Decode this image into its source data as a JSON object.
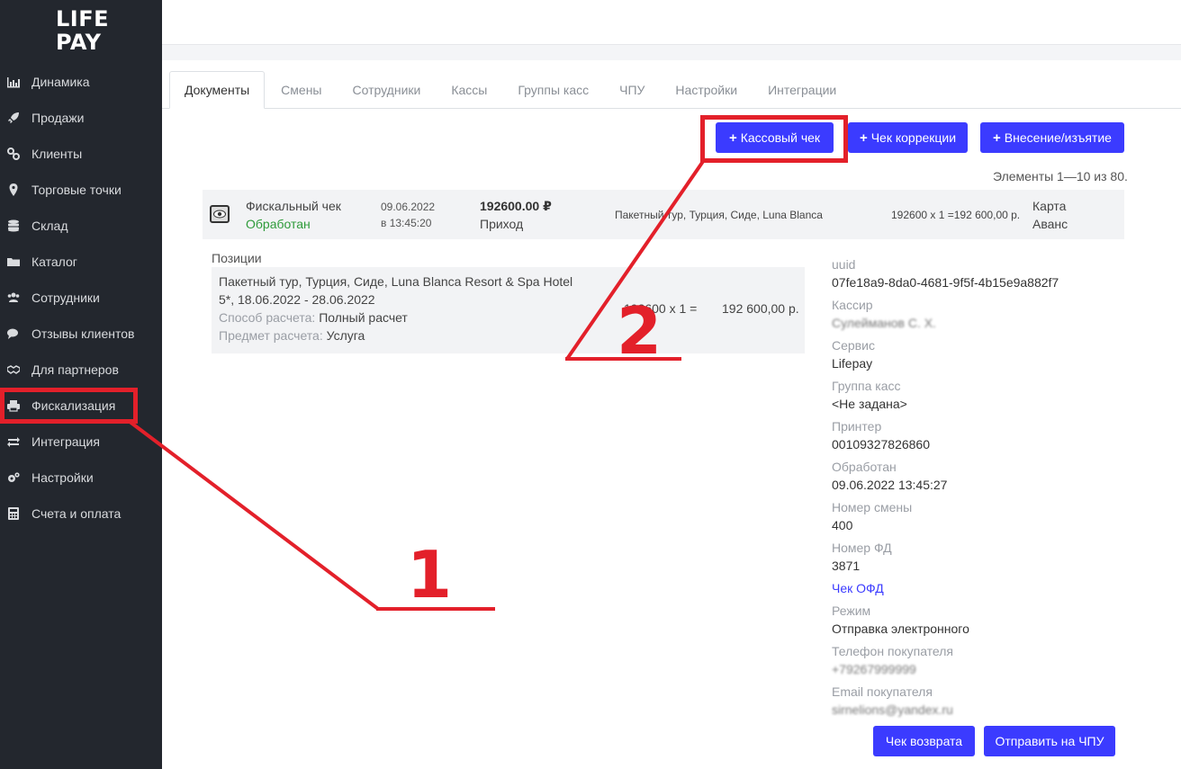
{
  "logo": {
    "line1": "LIFE",
    "line2": "PAY"
  },
  "sidebar": {
    "items": [
      {
        "label": "Динамика",
        "icon": "bar-chart-icon"
      },
      {
        "label": "Продажи",
        "icon": "rocket-icon"
      },
      {
        "label": "Клиенты",
        "icon": "link-icon"
      },
      {
        "label": "Торговые точки",
        "icon": "map-marker-icon"
      },
      {
        "label": "Склад",
        "icon": "database-icon"
      },
      {
        "label": "Каталог",
        "icon": "folder-icon"
      },
      {
        "label": "Сотрудники",
        "icon": "users-icon"
      },
      {
        "label": "Отзывы клиентов",
        "icon": "comments-icon"
      },
      {
        "label": "Для партнеров",
        "icon": "handshake-icon"
      },
      {
        "label": "Фискализация",
        "icon": "printer-icon"
      },
      {
        "label": "Интеграция",
        "icon": "exchange-icon"
      },
      {
        "label": "Настройки",
        "icon": "cogs-icon"
      },
      {
        "label": "Счета и оплата",
        "icon": "calculator-icon"
      }
    ]
  },
  "tabs": [
    "Документы",
    "Смены",
    "Сотрудники",
    "Кассы",
    "Группы касс",
    "ЧПУ",
    "Настройки",
    "Интеграции"
  ],
  "actions": {
    "cash_receipt": "Кассовый чек",
    "correction_receipt": "Чек коррекции",
    "deposit_withdrawal": "Внесение/изъятие"
  },
  "pagination": {
    "text": "Элементы 1—10 из 80."
  },
  "document": {
    "type": "Фискальный чек",
    "status": "Обработан",
    "date": "09.06.2022",
    "time": "в 13:45:20",
    "amount": "192600.00 ₽",
    "operation": "Приход",
    "description": "Пакетный тур, Турция, Сиде, Luna Blanca",
    "calc": "192600 x 1 =192 600,00 р.",
    "payment_method": "Карта",
    "payment_type": "Аванс"
  },
  "positions": {
    "label": "Позиции",
    "name_line1": "Пакетный тур, Турция, Сиде, Luna Blanca Resort & Spa Hotel",
    "name_line2": "5*, 18.06.2022 - 28.06.2022",
    "payment_method_label": "Способ расчета:",
    "payment_method_value": "Полный расчет",
    "subject_label": "Предмет расчета:",
    "subject_value": "Услуга",
    "qty_calc": "192600 x 1 =",
    "total": "192 600,00 р."
  },
  "details": [
    {
      "key": "uuid",
      "value": "07fe18a9-8da0-4681-9f5f-4b15e9a882f7"
    },
    {
      "key": "Кассир",
      "value": "Сулейманов С. Х.",
      "blurred": true
    },
    {
      "key": "Сервис",
      "value": "Lifepay"
    },
    {
      "key": "Группа касс",
      "value": "<Не задана>"
    },
    {
      "key": "Принтер",
      "value": "00109327826860"
    },
    {
      "key": "Обработан",
      "value": "09.06.2022 13:45:27"
    },
    {
      "key": "Номер смены",
      "value": "400"
    },
    {
      "key": "Номер ФД",
      "value": "3871"
    },
    {
      "key": "",
      "value": "Чек ОФД",
      "link": true
    },
    {
      "key": "Режим",
      "value": "Отправка электронного"
    },
    {
      "key": "Телефон покупателя",
      "value": "+79267999999",
      "blurred": true
    },
    {
      "key": "Email покупателя",
      "value": "sirnelions@yandex.ru",
      "blurred": true
    }
  ],
  "footer_actions": {
    "refund": "Чек возврата",
    "send_cpu": "Отправить на ЧПУ"
  },
  "annotations": {
    "marker1": "1",
    "marker2": "2",
    "color": "#e3202a"
  },
  "colors": {
    "accent": "#3b3bff",
    "sidebar": "#23272e",
    "status_ok": "#2e9b3a"
  }
}
